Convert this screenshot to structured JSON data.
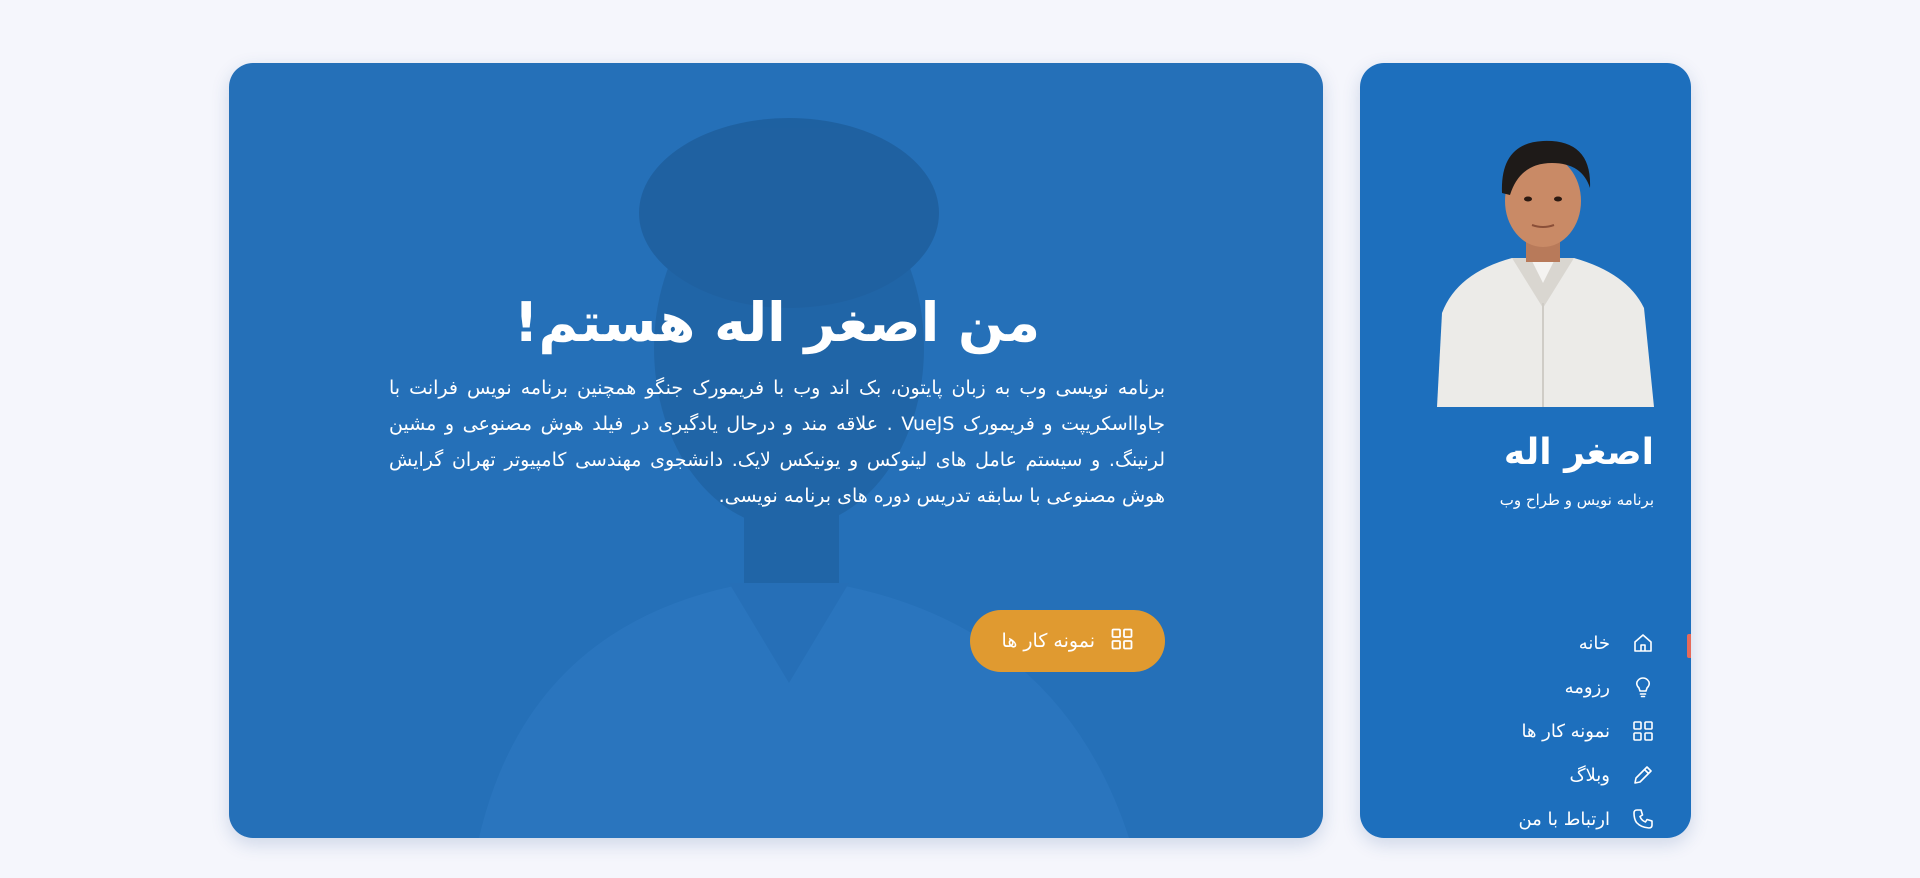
{
  "hero": {
    "title": "من اصغر اله هستم!",
    "description": "برنامه نویسی وب به زبان پایتون، بک اند وب با فریمورک جنگو همچنین برنامه نویس فرانت با جاوااسکریپت و فریمورک VueJS . علاقه مند و درحال یادگیری در فیلد هوش مصنوعی و مشین لرنینگ. و سیستم عامل های لینوکس و یونیکس لایک. دانشجوی مهندسی کامپیوتر تهران گرایش هوش مصنوعی با سابقه تدریس دوره های برنامه نویسی.",
    "cta_label": "نمونه کار ها",
    "cta_icon": "grid-icon"
  },
  "sidebar": {
    "name": "اصغر اله",
    "role": "برنامه نویس و طراح وب",
    "items": [
      {
        "label": "خانه",
        "icon": "home-icon"
      },
      {
        "label": "رزومه",
        "icon": "lightbulb-icon"
      },
      {
        "label": "نمونه کار ها",
        "icon": "grid-icon"
      },
      {
        "label": "وبلاگ",
        "icon": "pencil-icon"
      },
      {
        "label": "ارتباط با من",
        "icon": "phone-icon"
      }
    ],
    "active_index": 0
  },
  "colors": {
    "background": "#f5f6fc",
    "card": "#1d6fbd",
    "accent": "#e09a30",
    "active_marker": "#e66a5a"
  }
}
